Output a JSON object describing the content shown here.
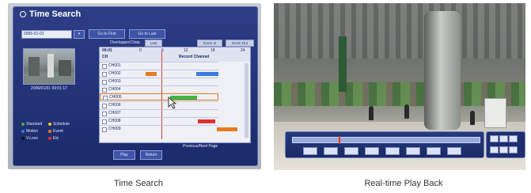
{
  "left": {
    "title": "Time Search",
    "date_value": "2006-01-01",
    "cal_label": "▾",
    "nav_buttons": [
      "Go to First",
      "Go to Last"
    ],
    "overlapped_label": "Overlapped Data",
    "overlap_buttons": [
      "Last",
      "Zoom In",
      "Zoom Out"
    ],
    "thumb_time": "2006/01/01  09:01:17",
    "grid_header": {
      "time": "09:01",
      "ticks": [
        "0",
        "6",
        "12",
        "18",
        "24"
      ],
      "col_ch": "CH",
      "col_record": "Record Channel"
    },
    "channels": [
      "CH001",
      "CH002",
      "CH003",
      "CH004",
      "CH005",
      "CH006",
      "CH007",
      "CH008",
      "CH009"
    ],
    "legend": [
      {
        "label": "Standard",
        "color": "#41b547"
      },
      {
        "label": "Schedule",
        "color": "#f2c230"
      },
      {
        "label": "Motion",
        "color": "#3a7be0"
      },
      {
        "label": "Event",
        "color": "#e67a1e"
      },
      {
        "label": "V.Loss",
        "color": "#111111"
      },
      {
        "label": "Etc",
        "color": "#e03030"
      }
    ],
    "page_info": "Previous/Next Page",
    "actions": [
      "Play",
      "Return"
    ],
    "caption": "Time Search"
  },
  "right": {
    "caption": "Real-time Play Back"
  },
  "colors": {
    "window_bg": "#24357a",
    "accent_red": "#e03a2a"
  }
}
